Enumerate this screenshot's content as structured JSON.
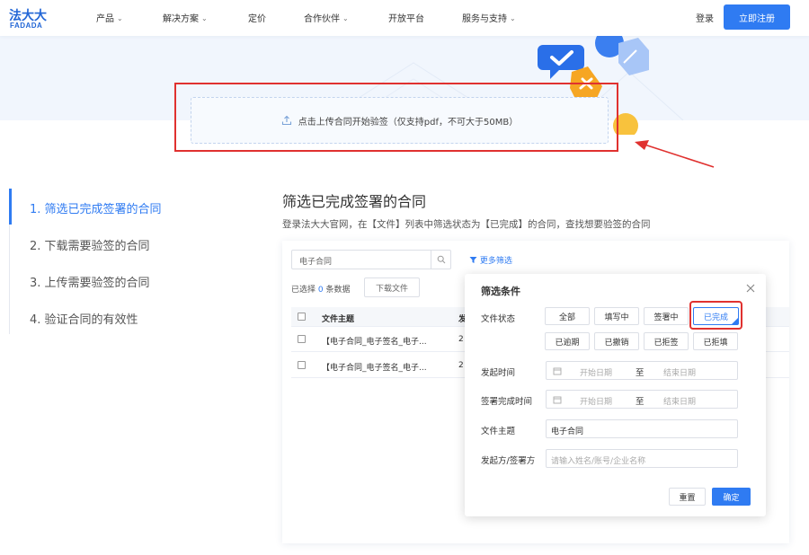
{
  "nav": {
    "logo_cn": "法大大",
    "logo_en": "FADADA",
    "items": [
      "产品",
      "解决方案",
      "定价",
      "合作伙伴",
      "开放平台",
      "服务与支持"
    ],
    "login": "登录",
    "register": "立即注册"
  },
  "upload": {
    "text": "点击上传合同开始验签（仅支持pdf，不可大于50MB）"
  },
  "steps": [
    "1. 筛选已完成签署的合同",
    "2. 下载需要验签的合同",
    "3. 上传需要验签的合同",
    "4. 验证合同的有效性"
  ],
  "content": {
    "title": "筛选已完成签署的合同",
    "desc": "登录法大大官网，在【文件】列表中筛选状态为【已完成】的合同，查找想要验签的合同"
  },
  "panel": {
    "search_value": "电子合同",
    "more_filter": "更多筛选",
    "selected_prefix": "已选择",
    "selected_count": "0",
    "selected_suffix": "条数据",
    "download": "下载文件",
    "headers": [
      "文件主题",
      "发"
    ],
    "rows": [
      {
        "subject": "【电子合同_电子签名_电子...",
        "col2": "2"
      },
      {
        "subject": "【电子合同_电子签名_电子...",
        "col2": "2"
      }
    ]
  },
  "filter": {
    "title": "筛选条件",
    "status_label": "文件状态",
    "status_chips": [
      "全部",
      "填写中",
      "签署中",
      "已完成",
      "已逾期",
      "已撤销",
      "已拒签",
      "已拒填"
    ],
    "selected_status": "已完成",
    "start_time_label": "发起时间",
    "finish_time_label": "签署完成时间",
    "date_start_placeholder": "开始日期",
    "date_to": "至",
    "date_end_placeholder": "结束日期",
    "subject_label": "文件主题",
    "subject_value": "电子合同",
    "party_label": "发起方/签署方",
    "party_placeholder": "请输入姓名/账号/企业名称",
    "reset": "重置",
    "confirm": "确定"
  },
  "colors": {
    "brand": "#2f7bf2",
    "highlight_red": "#e0312f",
    "hero_bg": "#f1f6fd"
  }
}
